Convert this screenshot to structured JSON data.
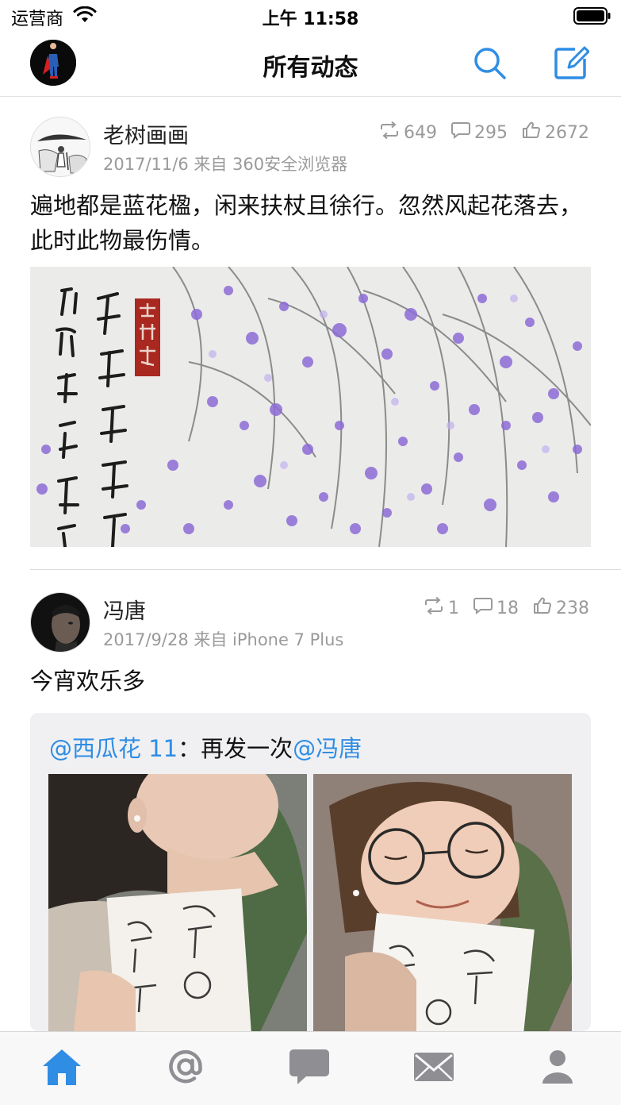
{
  "status_bar": {
    "carrier": "运营商",
    "time": "上午 11:58"
  },
  "nav": {
    "title": "所有动态",
    "left_icon": "user-avatar",
    "right_icons": [
      "search-icon",
      "compose-icon"
    ]
  },
  "posts": [
    {
      "author": "老树画画",
      "meta": "2017/11/6 来自 360安全浏览器",
      "reposts": "649",
      "comments": "295",
      "likes": "2672",
      "text": "遍地都是蓝花楹，闲来扶杖且徐行。忽然风起花落去，此时此物最伤情。",
      "image": "ink-painting-purple-jacaranda"
    },
    {
      "author": "冯唐",
      "meta": "2017/9/28 来自 iPhone 7 Plus",
      "reposts": "1",
      "comments": "18",
      "likes": "238",
      "text": "今宵欢乐多",
      "repost": {
        "mention_user": "@西瓜花 11",
        "separator": "：",
        "body": "再发一次",
        "mention_target": "@冯唐",
        "images": [
          "woman-with-book-photo-1",
          "woman-with-book-photo-2"
        ]
      }
    }
  ],
  "tab_bar": {
    "items": [
      {
        "icon": "home-icon",
        "active": true
      },
      {
        "icon": "at-icon",
        "active": false
      },
      {
        "icon": "chat-icon",
        "active": false
      },
      {
        "icon": "mail-icon",
        "active": false
      },
      {
        "icon": "profile-icon",
        "active": false
      }
    ],
    "active_color": "#2f8de4",
    "inactive_color": "#8e8e93"
  },
  "colors": {
    "accent": "#2f8de4",
    "meta_text": "#9a9a9a"
  }
}
